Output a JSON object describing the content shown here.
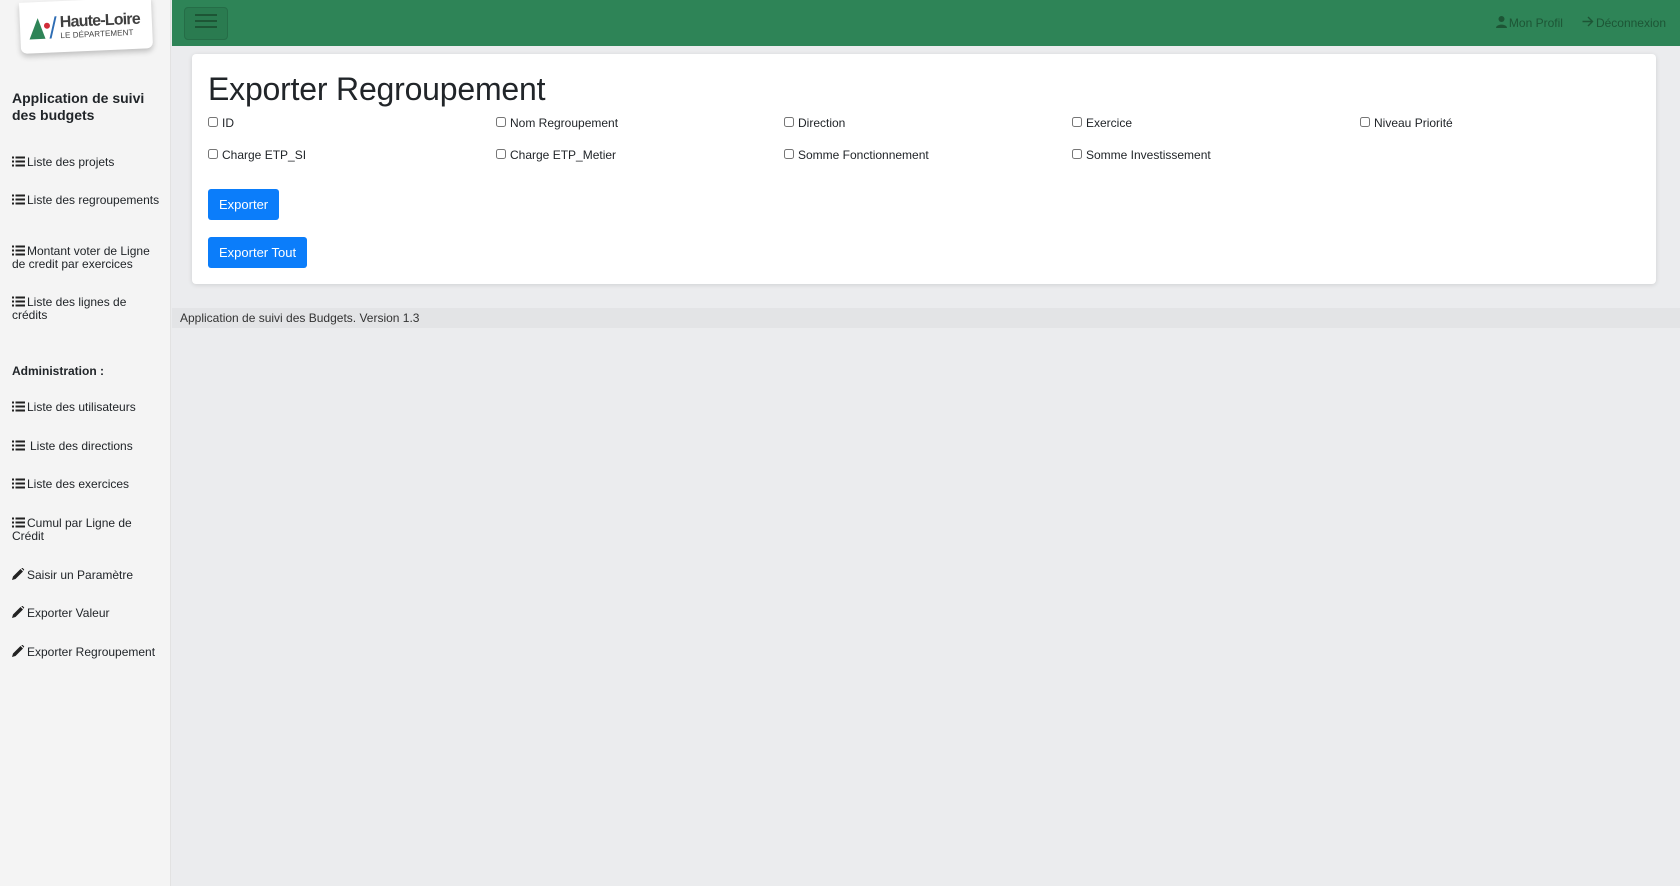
{
  "logo": {
    "name": "Haute-Loire",
    "subtitle": "LE DÉPARTEMENT"
  },
  "sidebar": {
    "app_title": "Application de suivi des budgets",
    "items": [
      {
        "label": "Liste des projets",
        "icon": "list-icon"
      },
      {
        "label": "Liste des regroupements",
        "icon": "list-icon"
      },
      {
        "label": "Montant voter de Ligne de credit par exercices",
        "icon": "list-icon"
      },
      {
        "label": "Liste des lignes de crédits",
        "icon": "list-icon"
      }
    ],
    "admin_heading": "Administration :",
    "admin_items": [
      {
        "label": "Liste des utilisateurs",
        "icon": "list-icon"
      },
      {
        "label": "Liste des directions",
        "icon": "list-icon"
      },
      {
        "label": "Liste des exercices",
        "icon": "list-icon"
      },
      {
        "label": "Cumul par Ligne de Crédit",
        "icon": "list-icon"
      },
      {
        "label": "Saisir un Paramètre",
        "icon": "pencil-icon"
      },
      {
        "label": "Exporter Valeur",
        "icon": "pencil-icon"
      },
      {
        "label": "Exporter Regroupement",
        "icon": "pencil-icon"
      }
    ]
  },
  "topbar": {
    "profile_label": "Mon Profil",
    "logout_label": "Déconnexion",
    "bg_color": "#2e8457"
  },
  "main": {
    "title": "Exporter Regroupement",
    "checkboxes": [
      {
        "label": "ID",
        "checked": false
      },
      {
        "label": "Nom Regroupement",
        "checked": false
      },
      {
        "label": "Direction",
        "checked": false
      },
      {
        "label": "Exercice",
        "checked": false
      },
      {
        "label": "Niveau Priorité",
        "checked": false
      },
      {
        "label": "Charge ETP_SI",
        "checked": false
      },
      {
        "label": "Charge ETP_Metier",
        "checked": false
      },
      {
        "label": "Somme Fonctionnement",
        "checked": false
      },
      {
        "label": "Somme Investissement",
        "checked": false
      }
    ],
    "export_button": "Exporter",
    "export_all_button": "Exporter Tout",
    "button_color": "#0b7dfa"
  },
  "footer": {
    "text": "Application de suivi des Budgets. Version 1.3"
  }
}
